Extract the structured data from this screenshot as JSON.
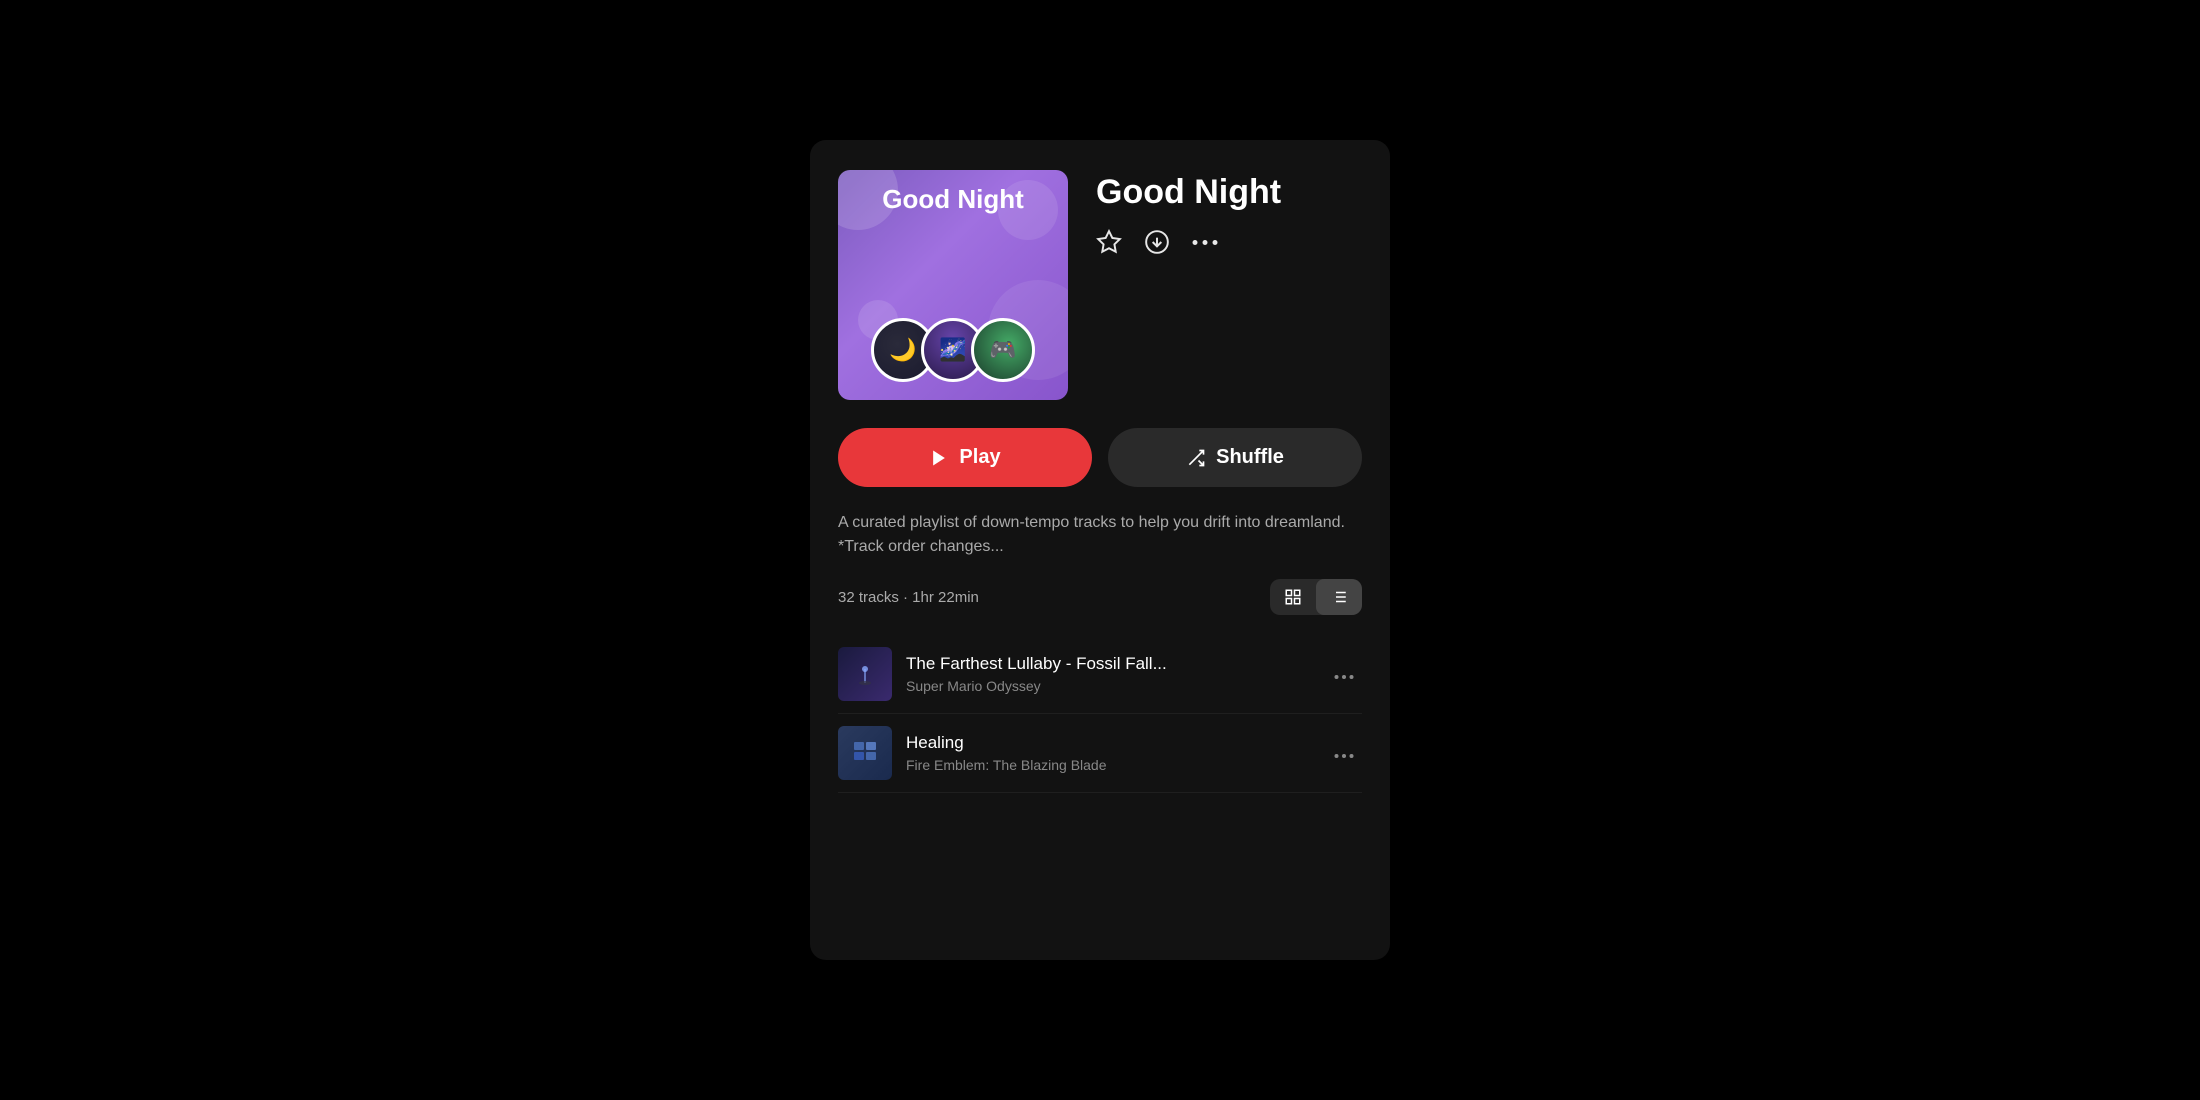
{
  "playlist": {
    "title": "Good Night",
    "artwork_label": "Good Night",
    "description": "A curated playlist of down-tempo tracks to help you drift into dreamland. *Track order changes...",
    "track_count": "32 tracks · 1hr 22min"
  },
  "buttons": {
    "play": "Play",
    "shuffle": "Shuffle",
    "star_icon": "☆",
    "download_icon": "⊙",
    "more_icon": "···"
  },
  "view_toggle": {
    "grid_label": "Grid view",
    "list_label": "List view"
  },
  "tracks": [
    {
      "name": "The Farthest Lullaby - Fossil Fall...",
      "artist": "Super Mario Odyssey",
      "more": "···"
    },
    {
      "name": "Healing",
      "artist": "Fire Emblem: The Blazing Blade",
      "more": "···"
    }
  ]
}
